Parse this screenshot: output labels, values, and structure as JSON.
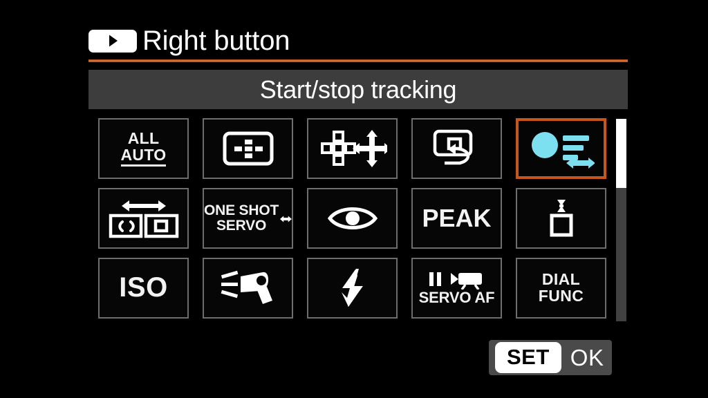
{
  "screen": {
    "background_color": "#000000",
    "accent_color": "#c4561f",
    "highlight_color": "#7de0f0"
  },
  "title": {
    "icon": "right-button-icon",
    "label": "Right button"
  },
  "header": {
    "label": "Start/stop tracking"
  },
  "grid": {
    "rows": 3,
    "columns": 5,
    "cells": [
      {
        "id": "all-auto",
        "type": "text",
        "icon": "all-auto-icon",
        "line1": "ALL",
        "line2": "AUTO",
        "selected": false
      },
      {
        "id": "af-area-select",
        "type": "icon",
        "icon": "af-area-frame-icon",
        "selected": false
      },
      {
        "id": "af-point-move",
        "type": "icon",
        "icon": "af-point-move-icon",
        "selected": false
      },
      {
        "id": "af-point-return",
        "type": "icon",
        "icon": "af-point-return-icon",
        "selected": false
      },
      {
        "id": "start-stop-tracking",
        "type": "icon",
        "icon": "subject-tracking-icon",
        "selected": true
      },
      {
        "id": "af-method-switch",
        "type": "icon",
        "icon": "af-method-switch-icon",
        "selected": false
      },
      {
        "id": "one-shot-servo",
        "type": "text",
        "icon": "one-shot-servo-icon",
        "line1": "ONE SHOT",
        "line2": "SERVO",
        "selected": false
      },
      {
        "id": "eye-detection-af",
        "type": "icon",
        "icon": "eye-detection-icon",
        "selected": false
      },
      {
        "id": "peaking",
        "type": "text",
        "icon": "peaking-icon",
        "line1": "PEAK",
        "selected": false
      },
      {
        "id": "magnify-focus-guide",
        "type": "icon",
        "icon": "focus-guide-icon",
        "selected": false
      },
      {
        "id": "iso-speed",
        "type": "text",
        "icon": "iso-icon",
        "line1": "ISO",
        "selected": false
      },
      {
        "id": "led-light",
        "type": "icon",
        "icon": "led-light-icon",
        "selected": false
      },
      {
        "id": "flash-function",
        "type": "icon",
        "icon": "flash-bolt-icon",
        "selected": false
      },
      {
        "id": "movie-servo-af-pause",
        "type": "text",
        "icon": "movie-servo-af-icon",
        "line1": "SERVO AF",
        "selected": false
      },
      {
        "id": "dial-func",
        "type": "text",
        "icon": "dial-func-icon",
        "line1": "DIAL",
        "line2": "FUNC",
        "selected": false
      }
    ]
  },
  "scrollbar": {
    "thumb_position_percent": 0,
    "thumb_size_percent": 34
  },
  "footer": {
    "set_label": "SET",
    "ok_label": "OK"
  }
}
